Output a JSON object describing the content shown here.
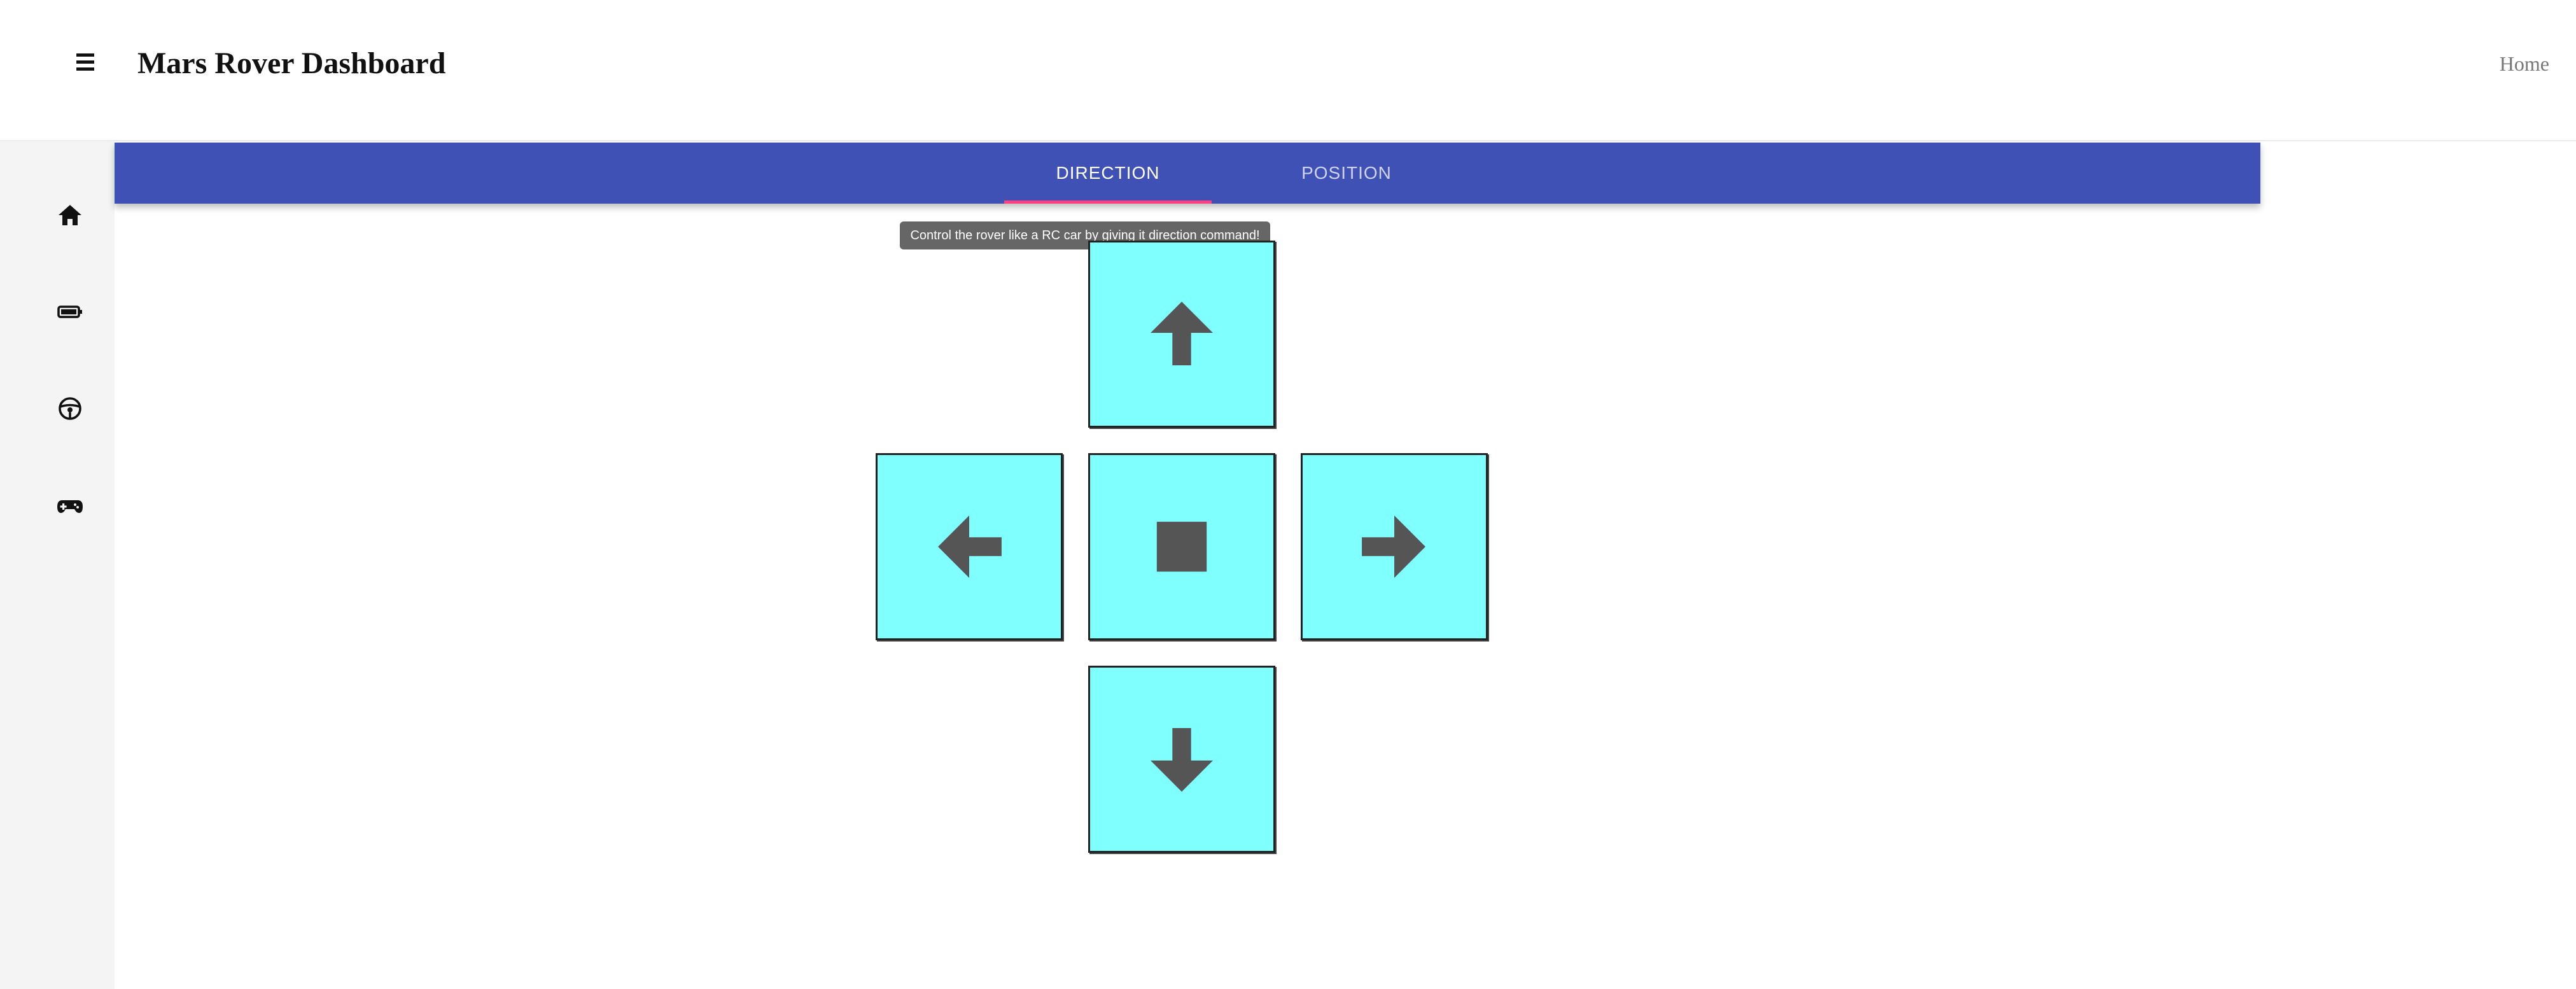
{
  "header": {
    "title": "Mars Rover Dashboard",
    "home_link": "Home",
    "menu_icon": "hamburger-menu-icon"
  },
  "sidebar": {
    "items": [
      {
        "icon": "home-icon"
      },
      {
        "icon": "battery-icon"
      },
      {
        "icon": "steering-wheel-icon"
      },
      {
        "icon": "gamepad-icon"
      }
    ]
  },
  "tabs": {
    "items": [
      {
        "label": "DIRECTION",
        "active": true
      },
      {
        "label": "POSITION",
        "active": false
      }
    ],
    "bar_color": "#3f51b5",
    "indicator_color": "#ff4081"
  },
  "tooltip": {
    "text": "Control the rover like a RC car by giving it direction command!"
  },
  "controls": {
    "button_color": "#80ffff",
    "icon_color": "#555555",
    "buttons": [
      {
        "icon": "arrow-up-icon"
      },
      {
        "icon": "arrow-left-icon"
      },
      {
        "icon": "stop-icon"
      },
      {
        "icon": "arrow-right-icon"
      },
      {
        "icon": "arrow-down-icon"
      }
    ]
  }
}
